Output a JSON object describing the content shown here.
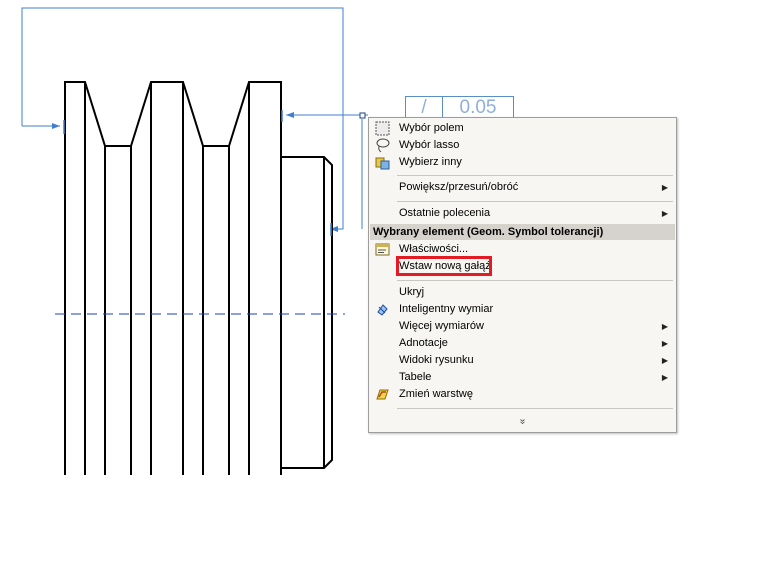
{
  "tolerance_frame": {
    "symbol": "/",
    "value": "0.05"
  },
  "context_menu": {
    "top_items": [
      {
        "label": "Wybór polem",
        "icon": "box-select-icon"
      },
      {
        "label": "Wybór lasso",
        "icon": "lasso-icon"
      },
      {
        "label": "Wybierz inny",
        "icon": "select-other-icon"
      }
    ],
    "zoom_item": {
      "label": "Powiększ/przesuń/obróć"
    },
    "recent_item": {
      "label": "Ostatnie polecenia"
    },
    "section_header": "Wybrany element (Geom. Symbol tolerancji)",
    "properties_item": {
      "label": "Właściwości...",
      "icon": "properties-icon"
    },
    "insert_branch_item": {
      "label": "Wstaw nową gałąź"
    },
    "lower_items": [
      {
        "label": "Ukryj",
        "submenu": false
      },
      {
        "label": "Inteligentny wymiar",
        "icon": "smart-dimension-icon",
        "submenu": false
      },
      {
        "label": "Więcej wymiarów",
        "submenu": true
      },
      {
        "label": "Adnotacje",
        "submenu": true
      },
      {
        "label": "Widoki rysunku",
        "submenu": true
      },
      {
        "label": "Tabele",
        "submenu": true
      },
      {
        "label": "Zmień warstwę",
        "icon": "change-layer-icon",
        "submenu": false
      }
    ],
    "more_label": "»"
  },
  "colors": {
    "selection_blue": "#3f7fd0",
    "highlight_red": "#e21b25",
    "centerline_blue": "#1f3fbf"
  }
}
